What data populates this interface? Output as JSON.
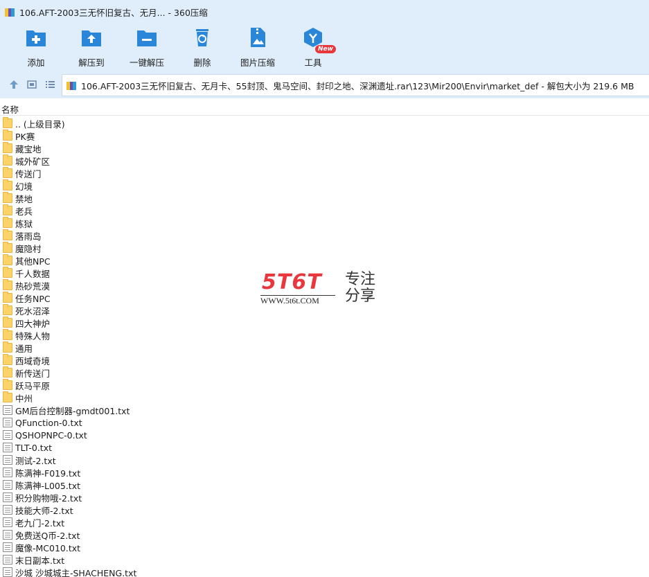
{
  "window": {
    "title": "106.AFT-2003三无怀旧复古、无月... - 360压缩"
  },
  "toolbar": {
    "items": [
      {
        "label": "添加",
        "icon": "add-icon"
      },
      {
        "label": "解压到",
        "icon": "extract-to-icon"
      },
      {
        "label": "一键解压",
        "icon": "one-click-extract-icon"
      },
      {
        "label": "删除",
        "icon": "delete-icon"
      },
      {
        "label": "图片压缩",
        "icon": "image-compress-icon"
      },
      {
        "label": "工具",
        "icon": "tools-icon"
      }
    ],
    "new_badge": "New"
  },
  "address": {
    "path": "106.AFT-2003三无怀旧复古、无月卡、55封顶、鬼马空间、封印之地、深渊遗址.rar\\123\\Mir200\\Envir\\market_def - 解包大小为 219.6 MB"
  },
  "columns": {
    "name": "名称"
  },
  "files": [
    {
      "name": ".. (上级目录)",
      "type": "folder"
    },
    {
      "name": "PK赛",
      "type": "folder"
    },
    {
      "name": "藏宝地",
      "type": "folder"
    },
    {
      "name": "城外矿区",
      "type": "folder"
    },
    {
      "name": "传送门",
      "type": "folder"
    },
    {
      "name": "幻境",
      "type": "folder"
    },
    {
      "name": "禁地",
      "type": "folder"
    },
    {
      "name": "老兵",
      "type": "folder"
    },
    {
      "name": "炼狱",
      "type": "folder"
    },
    {
      "name": "落雨岛",
      "type": "folder"
    },
    {
      "name": "魔隐村",
      "type": "folder"
    },
    {
      "name": "其他NPC",
      "type": "folder"
    },
    {
      "name": "千人数据",
      "type": "folder"
    },
    {
      "name": "热砂荒漠",
      "type": "folder"
    },
    {
      "name": "任务NPC",
      "type": "folder"
    },
    {
      "name": "死水沼泽",
      "type": "folder"
    },
    {
      "name": "四大神炉",
      "type": "folder"
    },
    {
      "name": "特殊人物",
      "type": "folder"
    },
    {
      "name": "通用",
      "type": "folder"
    },
    {
      "name": "西域奇境",
      "type": "folder"
    },
    {
      "name": "新传送门",
      "type": "folder"
    },
    {
      "name": "跃马平原",
      "type": "folder"
    },
    {
      "name": "中州",
      "type": "folder"
    },
    {
      "name": "GM后台控制器-gmdt001.txt",
      "type": "txt"
    },
    {
      "name": "QFunction-0.txt",
      "type": "txt"
    },
    {
      "name": "QSHOPNPC-0.txt",
      "type": "txt"
    },
    {
      "name": "TLT-0.txt",
      "type": "txt"
    },
    {
      "name": "测试-2.txt",
      "type": "txt"
    },
    {
      "name": "陈满神-F019.txt",
      "type": "txt"
    },
    {
      "name": "陈满神-L005.txt",
      "type": "txt"
    },
    {
      "name": "积分购物哦-2.txt",
      "type": "txt"
    },
    {
      "name": "技能大师-2.txt",
      "type": "txt"
    },
    {
      "name": "老九门-2.txt",
      "type": "txt"
    },
    {
      "name": "免费送Q币-2.txt",
      "type": "txt"
    },
    {
      "name": "魔像-MC010.txt",
      "type": "txt"
    },
    {
      "name": "末日副本.txt",
      "type": "txt"
    },
    {
      "name": "沙城 沙城城主-SHACHENG.txt",
      "type": "txt"
    }
  ],
  "watermark": {
    "logo": "5T6T",
    "url": "WWW.5t6t.COM",
    "slogan": "专注分享"
  }
}
